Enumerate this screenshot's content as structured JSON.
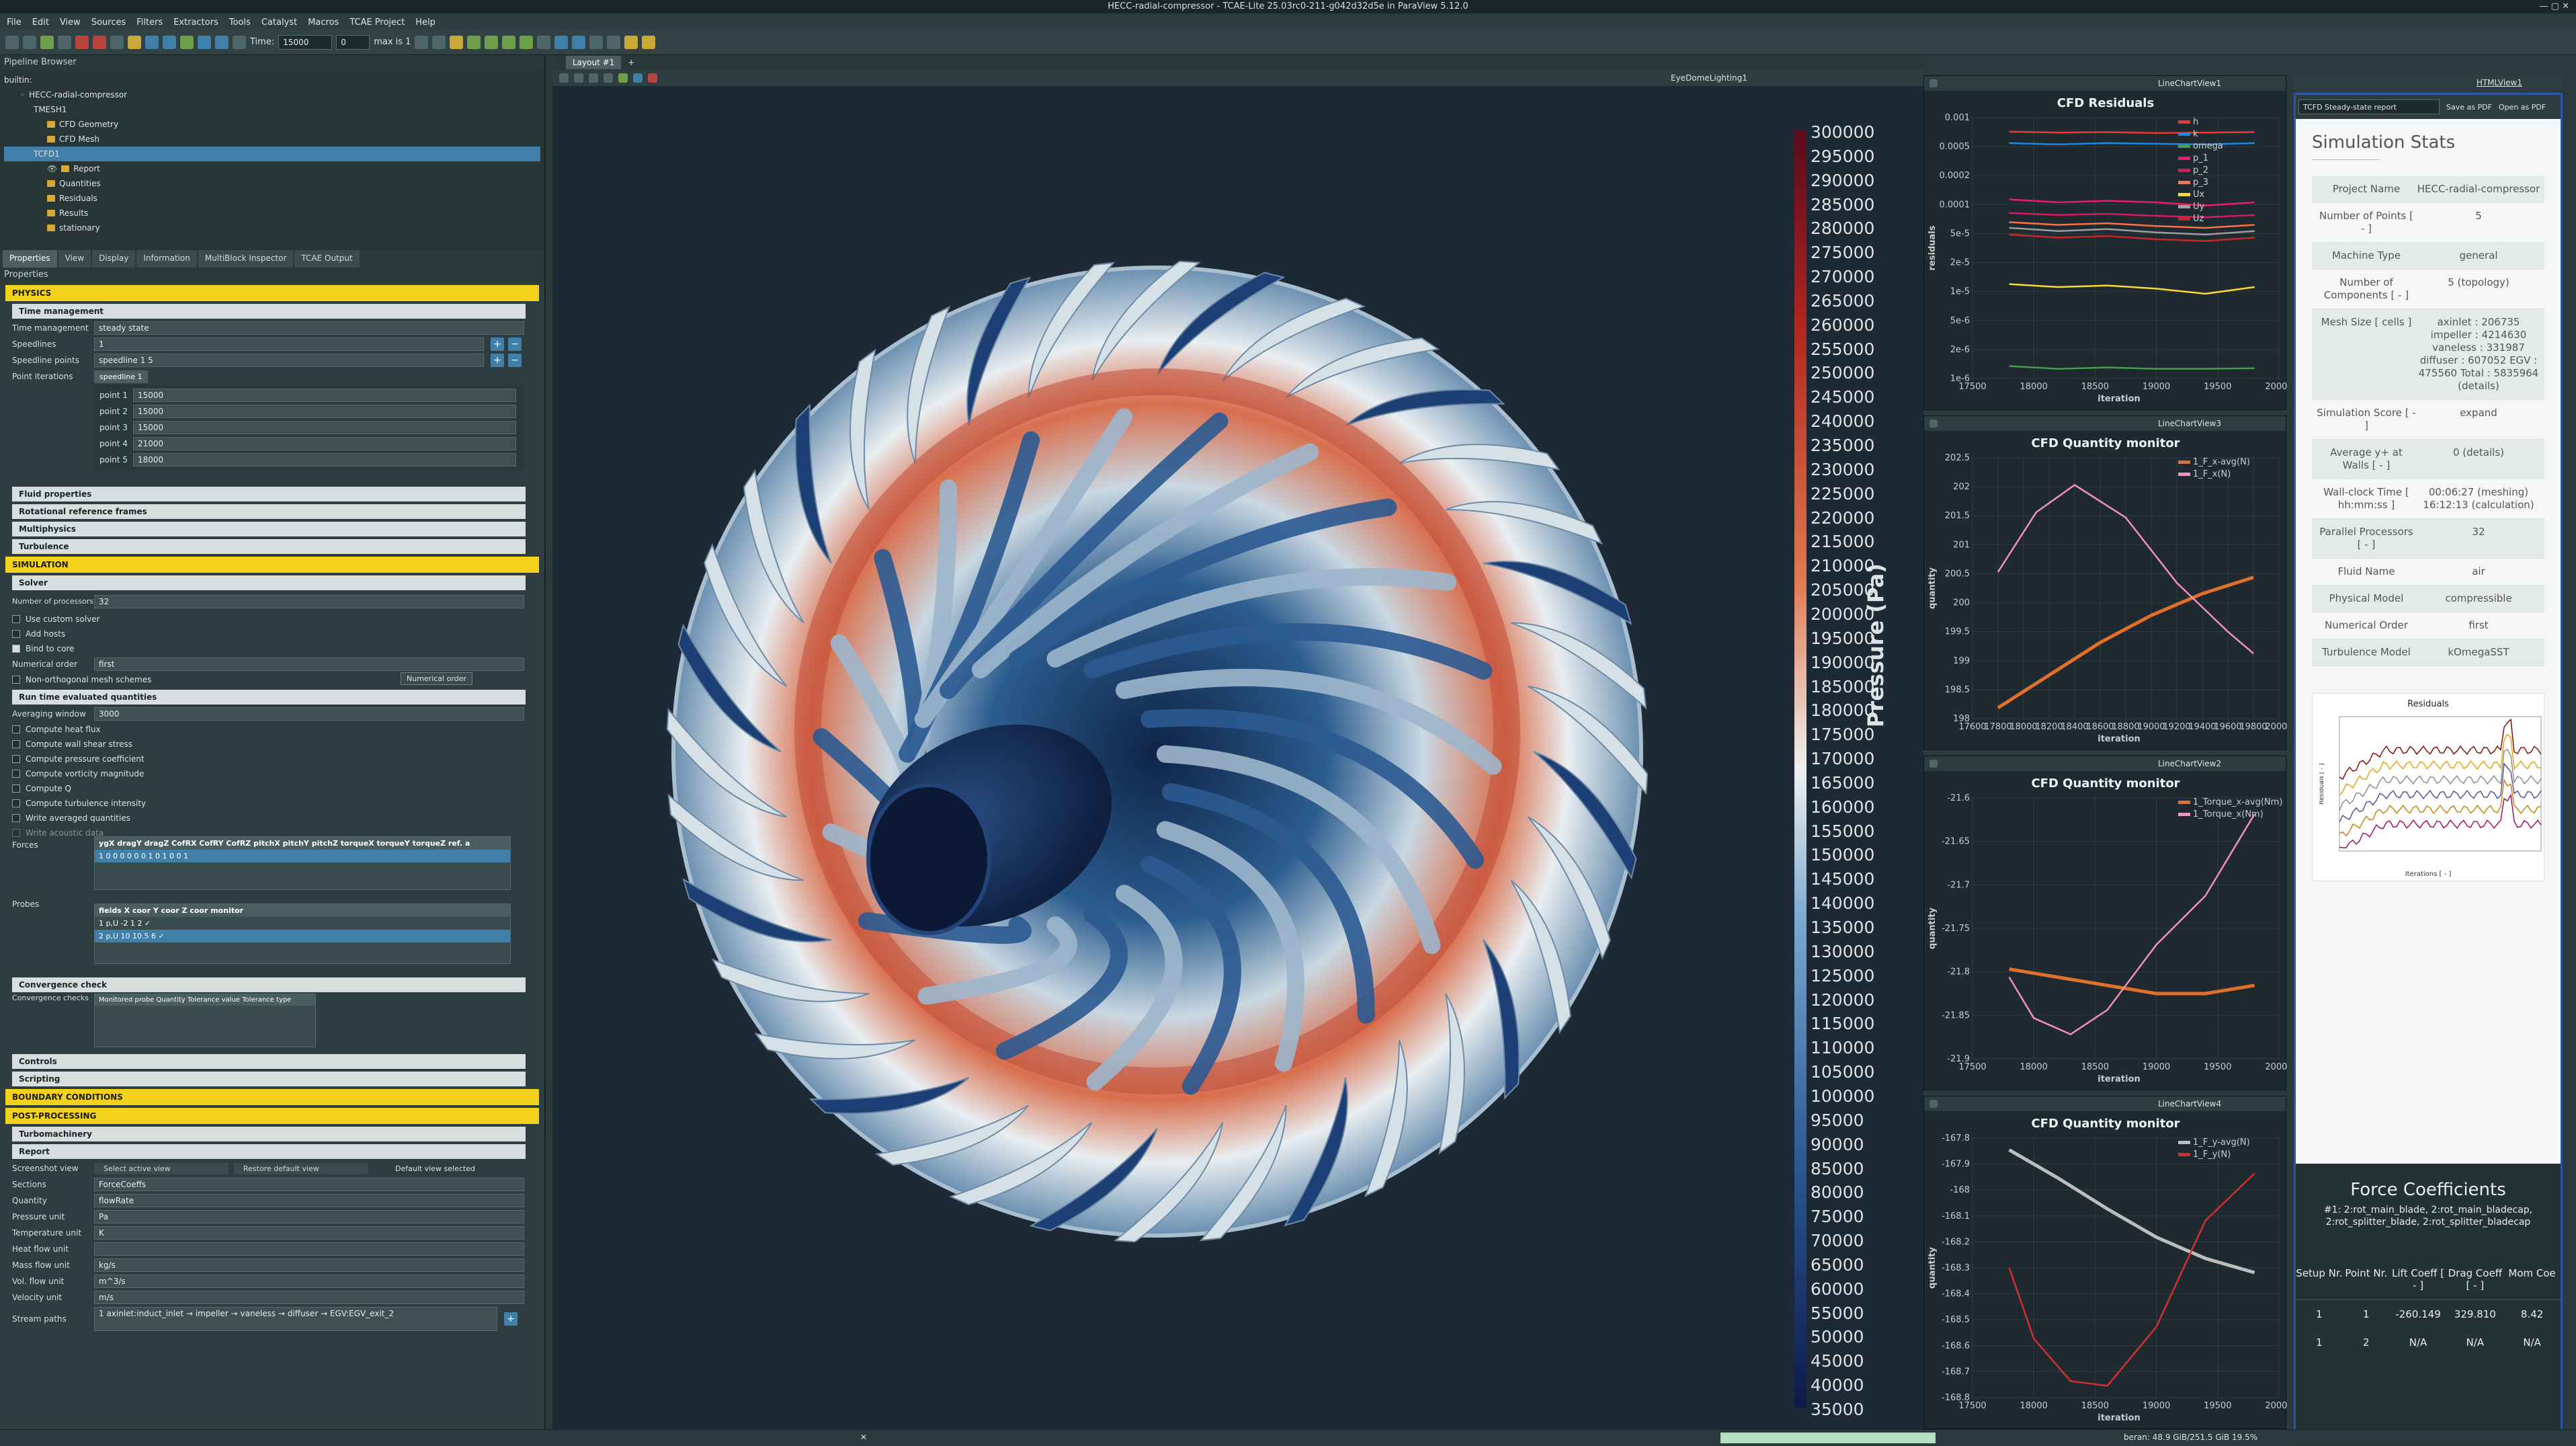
{
  "window": {
    "title": "HECC-radial-compressor - TCAE-Lite 25.03rc0-211-g042d32d5e in ParaView 5.12.0"
  },
  "menu": [
    "File",
    "Edit",
    "View",
    "Sources",
    "Filters",
    "Extractors",
    "Tools",
    "Catalyst",
    "Macros",
    "TCAE Project",
    "Help"
  ],
  "toolbar": {
    "time_label": "Time:",
    "time_value": "15000",
    "step_value": "0",
    "max_label": "max is 1"
  },
  "pipeline": {
    "header": "Pipeline Browser",
    "items": [
      "builtin:",
      "HECC-radial-compressor",
      "TMESH1",
      "CFD Geometry",
      "CFD Mesh",
      "TCFD1",
      "Report",
      "Quantities",
      "Residuals",
      "Results",
      "stationary"
    ]
  },
  "tabs": [
    "Properties",
    "View",
    "Display",
    "Information",
    "MultiBlock Inspector",
    "TCAE Output"
  ],
  "props": {
    "header": "Properties",
    "physics": "PHYSICS",
    "time_mgmt": "Time management",
    "tm_label": "Time management",
    "tm_value": "steady state",
    "speedlines_label": "Speedlines",
    "speedlines_value": "1",
    "sp_points_label": "Speedline points",
    "sp_points_value": "speedline 1  5",
    "point_iter_label": "Point iterations",
    "speedline_tab": "speedline 1",
    "points": [
      {
        "k": "point 1",
        "v": "15000"
      },
      {
        "k": "point 2",
        "v": "15000"
      },
      {
        "k": "point 3",
        "v": "15000"
      },
      {
        "k": "point 4",
        "v": "21000"
      },
      {
        "k": "point 5",
        "v": "18000"
      }
    ],
    "fluid": "Fluid properties",
    "rrf": "Rotational reference frames",
    "multiphysics": "Multiphysics",
    "turbulence": "Turbulence",
    "simulation": "SIMULATION",
    "solver": "Solver",
    "nproc_label": "Number of processors",
    "nproc_value": "32",
    "custom_solver": "Use custom solver",
    "add_hosts": "Add hosts",
    "bind_core": "Bind to core",
    "numorder_label": "Numerical order",
    "numorder_value": "first",
    "tooltip": "Numerical order",
    "nonortho": "Non-orthogonal mesh schemes",
    "rteq": "Run time evaluated quantities",
    "avg_label": "Averaging window",
    "avg_value": "3000",
    "checks": [
      "Compute heat flux",
      "Compute wall shear stress",
      "Compute pressure coefficient",
      "Compute vorticity magnitude",
      "Compute Q",
      "Compute turbulence intensity",
      "Write averaged quantities",
      "Write acoustic data"
    ],
    "forces_label": "Forces",
    "forces_head": "ygX dragY dragZ CofRX CofRY CofRZ pitchX pitchY pitchZ torqueX torqueY torqueZ ref. a",
    "forces_row": "1   0   0   0   0   0   0   1   0   1   0   0   1",
    "probes_label": "Probes",
    "probes_head": "fields  X coor  Y coor  Z coor  monitor",
    "probe_rows": [
      "1  p,U   -2    1     2     ✓",
      "2  p,U   10   10.5   6     ✓"
    ],
    "conv": "Convergence check",
    "conv_label": "Convergence checks",
    "conv_head": "Monitored probe   Quantity   Tolerance value   Tolerance type",
    "controls": "Controls",
    "scripting": "Scripting",
    "bc": "BOUNDARY CONDITIONS",
    "post": "POST-PROCESSING",
    "turbo": "Turbomachinery",
    "report": "Report",
    "screenshot_label": "Screenshot view",
    "select_view": "Select active view",
    "restore_view": "Restore default view",
    "default_view": "Default view selected",
    "sections_label": "Sections",
    "sections_value": "ForceCoeffs",
    "quantity_label": "Quantity",
    "quantity_value": "flowRate",
    "pu_label": "Pressure unit",
    "pu_value": "Pa",
    "tu_label": "Temperature unit",
    "tu_value": "K",
    "hf_label": "Heat flow unit",
    "hf_value": "",
    "mf_label": "Mass flow unit",
    "mf_value": "kg/s",
    "vf_label": "Vol. flow unit",
    "vf_value": "m^3/s",
    "vu_label": "Velocity unit",
    "vu_value": "m/s",
    "sp_label": "Stream paths",
    "sp_value": "1  axinlet:induct_inlet → impeller → vaneless → diffuser → EGV:EGV_exit_2"
  },
  "viewport": {
    "layout_tab": "Layout #1",
    "view_name": "EyeDomeLighting1",
    "colorbar_title": "Pressure (Pa)",
    "colorbar_ticks": [
      "300000",
      "295000",
      "290000",
      "285000",
      "280000",
      "275000",
      "270000",
      "265000",
      "260000",
      "255000",
      "250000",
      "245000",
      "240000",
      "235000",
      "230000",
      "225000",
      "220000",
      "215000",
      "210000",
      "205000",
      "200000",
      "195000",
      "190000",
      "185000",
      "180000",
      "175000",
      "170000",
      "165000",
      "160000",
      "155000",
      "150000",
      "145000",
      "140000",
      "135000",
      "130000",
      "125000",
      "120000",
      "115000",
      "110000",
      "105000",
      "100000",
      "95000",
      "90000",
      "85000",
      "80000",
      "75000",
      "70000",
      "65000",
      "60000",
      "55000",
      "50000",
      "45000",
      "40000",
      "35000"
    ]
  },
  "colors": {
    "accent_yellow": "#f2d21c",
    "selected_blue": "#3f7fa8",
    "low": "#162a5c",
    "mid": "#e8eef0",
    "high": "#a3201d"
  },
  "chart_data": [
    {
      "type": "line",
      "view": "LineChartView1",
      "title": "CFD Residuals",
      "xlabel": "iteration",
      "ylabel": "residuals",
      "xlim": [
        17500,
        20000
      ],
      "xticks": [
        "17500",
        "18000",
        "18500",
        "19000",
        "19500",
        "20000"
      ],
      "yticks": [
        "0.001",
        "0.0005",
        "0.0002",
        "0.0001",
        "5e-5",
        "2e-5",
        "1e-5",
        "5e-6",
        "2e-6",
        "1e-6"
      ],
      "legend": "top-right",
      "series": [
        {
          "name": "h",
          "color": "#e53935",
          "x": [
            17800,
            18200,
            18600,
            19000,
            19400,
            19800
          ],
          "y": [
            0.00082,
            0.0008,
            0.00081,
            0.00079,
            0.0008,
            0.00081
          ]
        },
        {
          "name": "k",
          "color": "#1e88e5",
          "x": [
            17800,
            18200,
            18600,
            19000,
            19400,
            19800
          ],
          "y": [
            0.0006,
            0.00058,
            0.0006,
            0.00059,
            0.00058,
            0.0006
          ]
        },
        {
          "name": "omega",
          "color": "#43a047",
          "x": [
            17800,
            18200,
            18600,
            19000,
            19400,
            19800
          ],
          "y": [
            1.4e-06,
            1.3e-06,
            1.35e-06,
            1.3e-06,
            1.3e-06,
            1.32e-06
          ]
        },
        {
          "name": "p_1",
          "color": "#e91e63",
          "x": [
            17800,
            18200,
            18600,
            19000,
            19400,
            19800
          ],
          "y": [
            0.00013,
            0.00012,
            0.000125,
            0.00012,
            0.00011,
            0.00012
          ]
        },
        {
          "name": "p_2",
          "color": "#d81b60",
          "x": [
            17800,
            18200,
            18600,
            19000,
            19400,
            19800
          ],
          "y": [
            9e-05,
            8.5e-05,
            8.8e-05,
            8.3e-05,
            8e-05,
            8.5e-05
          ]
        },
        {
          "name": "p_3",
          "color": "#ff7043",
          "x": [
            17800,
            18200,
            18600,
            19000,
            19400,
            19800
          ],
          "y": [
            7e-05,
            6.5e-05,
            6.8e-05,
            6.3e-05,
            6e-05,
            6.5e-05
          ]
        },
        {
          "name": "Ux",
          "color": "#fdd835",
          "x": [
            17800,
            18200,
            18600,
            19000,
            19400,
            19800
          ],
          "y": [
            1.3e-05,
            1.2e-05,
            1.25e-05,
            1.15e-05,
            1e-05,
            1.2e-05
          ]
        },
        {
          "name": "Uy",
          "color": "#9e9e9e",
          "x": [
            17800,
            18200,
            18600,
            19000,
            19400,
            19800
          ],
          "y": [
            6e-05,
            5.5e-05,
            5.8e-05,
            5.3e-05,
            5e-05,
            5.5e-05
          ]
        },
        {
          "name": "Uz",
          "color": "#c62828",
          "x": [
            17800,
            18200,
            18600,
            19000,
            19400,
            19800
          ],
          "y": [
            5e-05,
            4.6e-05,
            4.8e-05,
            4.4e-05,
            4.2e-05,
            4.6e-05
          ]
        }
      ]
    },
    {
      "type": "line",
      "view": "LineChartView3",
      "title": "CFD Quantity monitor",
      "xlabel": "iteration",
      "ylabel": "quantity",
      "xlim": [
        17600,
        20000
      ],
      "ylim": [
        197.8,
        202.6
      ],
      "xticks": [
        "17600",
        "17800",
        "18000",
        "18200",
        "18400",
        "18600",
        "18800",
        "19000",
        "19200",
        "19400",
        "19600",
        "19800",
        "20000"
      ],
      "yticks": [
        "202.5",
        "202",
        "201.5",
        "201",
        "200.5",
        "200",
        "199.5",
        "199",
        "198.5",
        "198"
      ],
      "legend": "top-right",
      "series": [
        {
          "name": "1_F_x-avg(N)",
          "color": "#e0702a",
          "x": [
            17800,
            18200,
            18600,
            19000,
            19400,
            19800
          ],
          "y": [
            198.0,
            198.6,
            199.2,
            199.7,
            200.1,
            200.4
          ]
        },
        {
          "name": "1_F_x(N)",
          "color": "#f48fc0",
          "x": [
            17800,
            18100,
            18400,
            18800,
            19200,
            19600,
            19800
          ],
          "y": [
            200.5,
            201.6,
            202.1,
            201.5,
            200.3,
            199.4,
            199.0
          ]
        }
      ]
    },
    {
      "type": "line",
      "view": "LineChartView2",
      "title": "CFD Quantity monitor",
      "xlabel": "iteration",
      "ylabel": "quantity",
      "xlim": [
        17500,
        20000
      ],
      "ylim": [
        -21.9,
        -21.58
      ],
      "xticks": [
        "17500",
        "18000",
        "18500",
        "19000",
        "19500",
        "20000"
      ],
      "yticks": [
        "-21.6",
        "-21.65",
        "-21.7",
        "-21.75",
        "-21.8",
        "-21.85",
        "-21.9"
      ],
      "legend": "top-right",
      "series": [
        {
          "name": "1_Torque_x-avg(Nm)",
          "color": "#e0702a",
          "x": [
            17800,
            18200,
            18600,
            19000,
            19400,
            19800
          ],
          "y": [
            -21.79,
            -21.8,
            -21.81,
            -21.82,
            -21.82,
            -21.81
          ]
        },
        {
          "name": "1_Torque_x(Nm)",
          "color": "#f48fc0",
          "x": [
            17800,
            18000,
            18300,
            18600,
            19000,
            19400,
            19800
          ],
          "y": [
            -21.8,
            -21.85,
            -21.87,
            -21.84,
            -21.76,
            -21.7,
            -21.6
          ]
        }
      ]
    },
    {
      "type": "line",
      "view": "LineChartView4",
      "title": "CFD Quantity monitor",
      "xlabel": "iteration",
      "ylabel": "quantity",
      "xlim": [
        17500,
        20000
      ],
      "ylim": [
        -168.85,
        -167.75
      ],
      "xticks": [
        "17500",
        "18000",
        "18500",
        "19000",
        "19500",
        "20000"
      ],
      "yticks": [
        "-167.8",
        "-167.9",
        "-168",
        "-168.1",
        "-168.2",
        "-168.3",
        "-168.4",
        "-168.5",
        "-168.6",
        "-168.7",
        "-168.8"
      ],
      "legend": "top-right",
      "series": [
        {
          "name": "1_F_y-avg(N)",
          "color": "#bdbdbd",
          "x": [
            17800,
            18200,
            18600,
            19000,
            19400,
            19800
          ],
          "y": [
            -167.8,
            -167.92,
            -168.05,
            -168.17,
            -168.26,
            -168.32
          ]
        },
        {
          "name": "1_F_y(N)",
          "color": "#d32f2f",
          "x": [
            17800,
            18000,
            18300,
            18600,
            19000,
            19400,
            19800
          ],
          "y": [
            -168.3,
            -168.6,
            -168.78,
            -168.8,
            -168.55,
            -168.1,
            -167.9
          ]
        }
      ]
    }
  ],
  "html_view": {
    "name": "HTMLView1",
    "report_select": "TCFD Steady-state report",
    "save_pdf": "Save as PDF",
    "open_pdf": "Open as PDF",
    "title": "Simulation Stats",
    "stats": [
      {
        "k": "Project Name",
        "v": "HECC-radial-compressor"
      },
      {
        "k": "Number of Points [ - ]",
        "v": "5"
      },
      {
        "k": "Machine Type",
        "v": "general"
      },
      {
        "k": "Number of Components [ - ]",
        "v": "5 (topology)"
      },
      {
        "k": "Mesh Size [ cells ]",
        "v": "axinlet : 206735 impeller : 4214630 vaneless : 331987 diffuser : 607052 EGV : 475560 Total : 5835964 (details)"
      },
      {
        "k": "Simulation Score [ - ]",
        "v": "expand"
      },
      {
        "k": "Average y+ at Walls [ - ]",
        "v": "0 (details)"
      },
      {
        "k": "Wall-clock Time [ hh:mm:ss ]",
        "v": "00:06:27 (meshing) 16:12:13 (calculation)"
      },
      {
        "k": "Parallel Processors [ - ]",
        "v": "32"
      },
      {
        "k": "Fluid Name",
        "v": "air"
      },
      {
        "k": "Physical Model",
        "v": "compressible"
      },
      {
        "k": "Numerical Order",
        "v": "first"
      },
      {
        "k": "Turbulence Model",
        "v": "kOmegaSST"
      }
    ],
    "mini_title": "Residuals",
    "mini_x": "Iterations [ - ]",
    "mini_y": "Residuals [ - ]",
    "force_title": "Force Coefficients",
    "force_sub": "#1: 2:rot_main_blade, 2:rot_main_bladecap, 2:rot_splitter_blade, 2:rot_splitter_bladecap",
    "force_head": [
      "Setup Nr.",
      "Point Nr.",
      "Lift Coeff [ - ]",
      "Drag Coeff [ - ]",
      "Mom Coe"
    ],
    "force_rows": [
      [
        "1",
        "1",
        "-260.149",
        "329.810",
        "8.42"
      ],
      [
        "1",
        "2",
        "N/A",
        "N/A",
        "N/A"
      ]
    ]
  },
  "status": {
    "memory": "beran: 48.9 GiB/251.5 GiB 19.5%"
  }
}
